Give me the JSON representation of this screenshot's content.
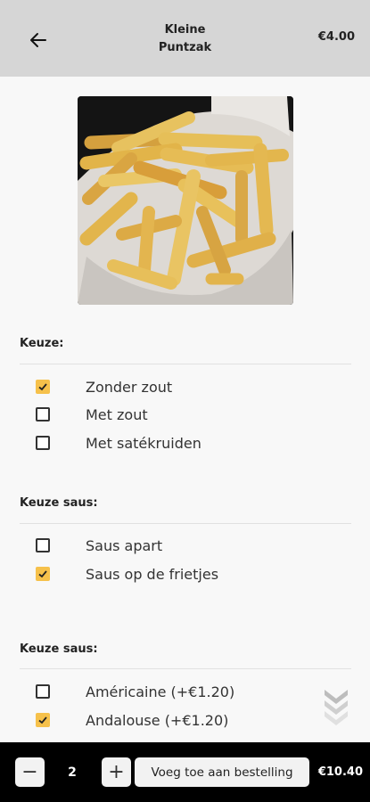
{
  "header": {
    "title_line1": "Kleine",
    "title_line2": "Puntzak",
    "price": "€4.00",
    "back_icon": "arrow-left-icon"
  },
  "product": {
    "image": "fries-in-paper-cone-photo"
  },
  "sections": [
    {
      "title": "Keuze:",
      "options": [
        {
          "label": "Zonder zout",
          "checked": true
        },
        {
          "label": "Met zout",
          "checked": false
        },
        {
          "label": "Met satékruiden",
          "checked": false
        }
      ]
    },
    {
      "title": "Keuze saus:",
      "options": [
        {
          "label": "Saus apart",
          "checked": false
        },
        {
          "label": "Saus op de frietjes",
          "checked": true
        }
      ]
    },
    {
      "title": "Keuze saus:",
      "options": [
        {
          "label": "Américaine (+€1.20)",
          "checked": false
        },
        {
          "label": "Andalouse (+€1.20)",
          "checked": true
        }
      ]
    }
  ],
  "scroll_hint_icon": "chevrons-down-icon",
  "bottom_bar": {
    "minus_label": "−",
    "quantity": "2",
    "plus_label": "+",
    "add_button_label": "Voeg toe aan bestelling",
    "total": "€10.40"
  },
  "colors": {
    "header_bg": "#d6d6d6",
    "checkbox_checked": "#f6c14b",
    "bottom_bar_bg": "#000000"
  }
}
